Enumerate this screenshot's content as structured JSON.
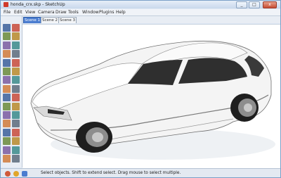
{
  "window": {
    "title": "honda_crx.skp - SketchUp",
    "minimize_label": "_",
    "maximize_label": "□",
    "close_label": "x"
  },
  "menu": [
    "File",
    "Edit",
    "View",
    "Camera",
    "Draw",
    "Tools",
    "Window",
    "Plugins",
    "Help"
  ],
  "scenes": [
    {
      "label": "Scene 1",
      "active": true
    },
    {
      "label": "Scene 2",
      "active": false
    },
    {
      "label": "Scene 3",
      "active": false
    }
  ],
  "toolbar": {
    "tools": [
      "select-icon",
      "eraser-icon",
      "line-icon",
      "paint-bucket-icon",
      "rectangle-icon",
      "push-pull-icon",
      "circle-icon",
      "move-icon",
      "polygon-icon",
      "rotate-icon",
      "arc-icon",
      "follow-me-icon",
      "freehand-icon",
      "scale-icon",
      "offset-icon",
      "tape-measure-icon",
      "dimension-icon",
      "protractor-icon",
      "text-icon",
      "axes-icon",
      "3d-text-icon",
      "orbit-icon",
      "pan-icon",
      "zoom-icon",
      "zoom-window-icon",
      "zoom-extents-icon",
      "previous-view-icon",
      "next-view-icon",
      "position-camera-icon",
      "walk-icon",
      "look-around-icon",
      "section-plane-icon"
    ]
  },
  "status": {
    "text": "Select objects. Shift to extend select. Drag mouse to select multiple.",
    "icons": [
      "geo-location-icon",
      "credits-icon",
      "help-icon"
    ]
  },
  "colors": {
    "car_body": "#f2f2f2",
    "glass": "#2f2f2f",
    "tire": "#1e1e1e",
    "accent": "#4a7ccf"
  }
}
